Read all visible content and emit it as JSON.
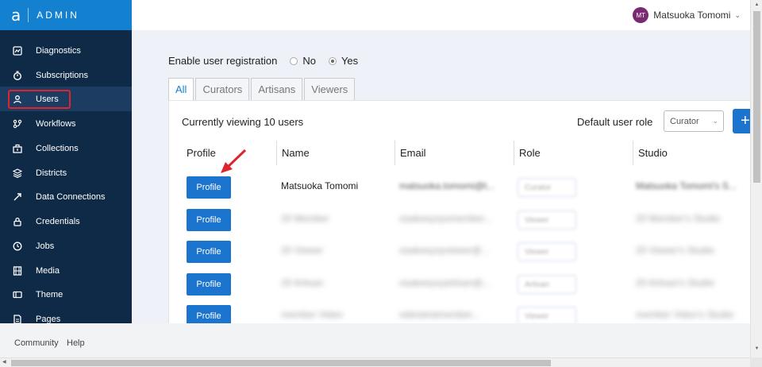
{
  "brand": {
    "logo": "a",
    "title": "ADMIN"
  },
  "sidebar": {
    "items": [
      {
        "label": "Diagnostics",
        "icon": "chart-icon"
      },
      {
        "label": "Subscriptions",
        "icon": "stopwatch-icon"
      },
      {
        "label": "Users",
        "icon": "user-icon",
        "active": true
      },
      {
        "label": "Workflows",
        "icon": "workflow-icon"
      },
      {
        "label": "Collections",
        "icon": "collection-icon"
      },
      {
        "label": "Districts",
        "icon": "layers-icon"
      },
      {
        "label": "Data Connections",
        "icon": "link-arrow-icon"
      },
      {
        "label": "Credentials",
        "icon": "lock-icon"
      },
      {
        "label": "Jobs",
        "icon": "clock-icon"
      },
      {
        "label": "Media",
        "icon": "film-icon"
      },
      {
        "label": "Theme",
        "icon": "theme-icon"
      },
      {
        "label": "Pages",
        "icon": "page-icon"
      }
    ]
  },
  "header": {
    "avatar_initials": "MT",
    "user_name": "Matsuoka Tomomi",
    "avatar_color": "#7a2a70"
  },
  "registration": {
    "label": "Enable user registration",
    "no_label": "No",
    "yes_label": "Yes",
    "selected": "Yes"
  },
  "tabs": [
    {
      "label": "All",
      "active": true
    },
    {
      "label": "Curators"
    },
    {
      "label": "Artisans"
    },
    {
      "label": "Viewers"
    }
  ],
  "panel": {
    "viewing_text": "Currently viewing 10 users",
    "default_role_label": "Default user role",
    "default_role_value": "Curator",
    "add_label": "+"
  },
  "table": {
    "columns": [
      "Profile",
      "Name",
      "Email",
      "Role",
      "Studio"
    ],
    "profile_button_label": "Profile",
    "rows": [
      {
        "name": "Matsuoka Tomomi",
        "email": "matsuoka.tomomi@t...",
        "role": "Curator",
        "studio": "Matsuoka Tomomi's S..."
      },
      {
        "name": "20 Member",
        "email": "osakeeyxyomember...",
        "role": "Viewer",
        "studio": "20 Member's Studio"
      },
      {
        "name": "20 Viewer",
        "email": "osakeeyxyviewer@...",
        "role": "Viewer",
        "studio": "20 Viewer's Studio"
      },
      {
        "name": "20 Artisan",
        "email": "osakeeyxyartisan@...",
        "role": "Artisan",
        "studio": "20 Artisan's Studio"
      },
      {
        "name": "member Video",
        "email": "videotestmember...",
        "role": "Viewer",
        "studio": "member Video's Studio"
      }
    ]
  },
  "footer": {
    "community": "Community",
    "help": "Help"
  },
  "colors": {
    "sidebar": "#0f2a47",
    "brand": "#1481d0",
    "primary": "#1b75cf",
    "highlight": "#e0242e"
  }
}
